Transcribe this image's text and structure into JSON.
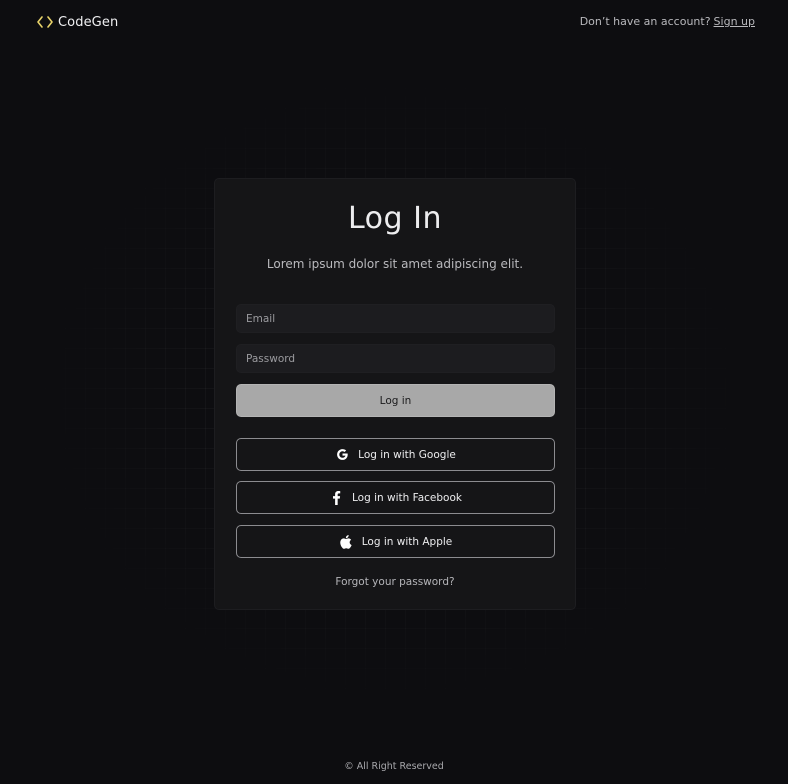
{
  "header": {
    "brand_name": "CodeGen",
    "brand_icon": "code-brackets-icon",
    "signup_prompt": "Don’t have an account?",
    "signup_link": "Sign up"
  },
  "card": {
    "title": "Log In",
    "subtitle": "Lorem ipsum dolor sit amet adipiscing elit.",
    "email": {
      "placeholder": "Email",
      "value": ""
    },
    "password": {
      "placeholder": "Password",
      "value": ""
    },
    "login_button": "Log in",
    "social": [
      {
        "label": "Log in with Google",
        "icon": "google-icon"
      },
      {
        "label": "Log in with Facebook",
        "icon": "facebook-icon"
      },
      {
        "label": "Log in with Apple",
        "icon": "apple-icon"
      }
    ],
    "forgot_password": "Forgot your password?"
  },
  "footer": {
    "text": "© All Right Reserved"
  },
  "colors": {
    "background": "#0d0d10",
    "card": "#151517",
    "input": "#1c1c1f",
    "login_button": "#a8a8a8",
    "brand_accent": "#e8d36a",
    "social_border": "#8c8c90"
  }
}
